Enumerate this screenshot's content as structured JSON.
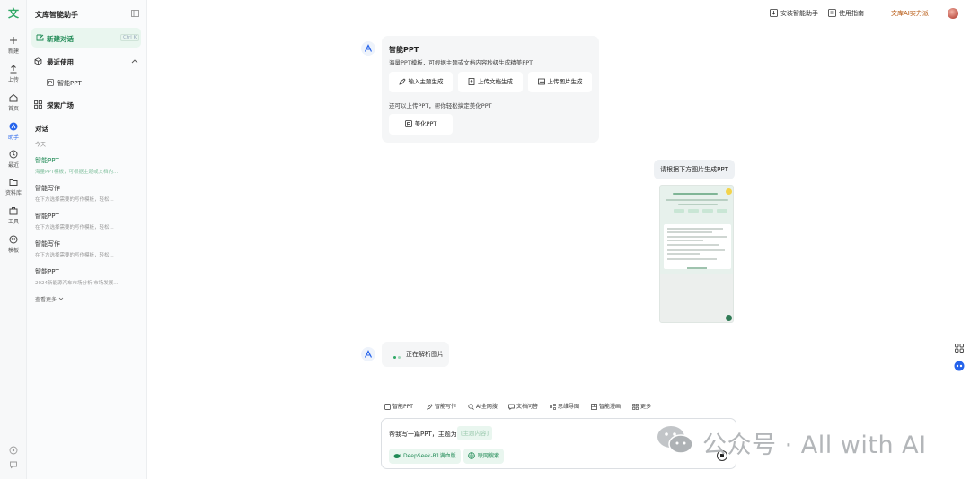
{
  "app": {
    "logo": "文",
    "title": "文库智能助手"
  },
  "rail": [
    {
      "name": "new",
      "label": "新建"
    },
    {
      "name": "upload",
      "label": "上传"
    },
    {
      "name": "home",
      "label": "首页"
    },
    {
      "name": "assistant",
      "label": "助手"
    },
    {
      "name": "recent",
      "label": "最近"
    },
    {
      "name": "library",
      "label": "资料库"
    },
    {
      "name": "tools",
      "label": "工具"
    },
    {
      "name": "templates",
      "label": "模板"
    }
  ],
  "sidebar": {
    "new_chat": "新建对话",
    "new_chat_kbd": "Ctrl K",
    "recent_title": "最近使用",
    "recent_items": [
      "智能PPT"
    ],
    "explore": "探索广场",
    "conversations_title": "对话",
    "today": "今天",
    "conversations": [
      {
        "title": "智能PPT",
        "desc": "海量PPT模板，可根据主题或文档内..."
      },
      {
        "title": "智能写作",
        "desc": "在下方选择需要的写作模板，轻松..."
      },
      {
        "title": "智能PPT",
        "desc": "在下方选择需要的写作模板，轻松..."
      },
      {
        "title": "智能写作",
        "desc": "在下方选择需要的写作模板，轻松..."
      },
      {
        "title": "智能PPT",
        "desc": "2024新能源汽车市场分析 市场发展..."
      }
    ],
    "see_more": "查看更多"
  },
  "topbar": {
    "install": "安装智能助手",
    "guide": "使用指南",
    "vip": "文库AI实力派"
  },
  "card": {
    "title": "智能PPT",
    "desc": "海量PPT模板，可根据主题或文档内容秒级生成精美PPT",
    "options": [
      "输入主题生成",
      "上传文档生成",
      "上传图片生成"
    ],
    "note": "还可以上传PPT，帮你轻松搞定美化PPT",
    "beautify": "美化PPT"
  },
  "user_message": "请根据下方图片生成PPT",
  "parsing": "正在解析图片",
  "tools": [
    "智能PPT",
    "智能写作",
    "AI全网搜",
    "文档问答",
    "思维导图",
    "智能漫画",
    "更多"
  ],
  "composer": {
    "prompt": "帮我写一篇PPT，主题为",
    "slot": "[主题内容]",
    "chips": [
      "DeepSeek-R1满血版",
      "联网搜索"
    ]
  },
  "watermark": "公众号 · All with AI",
  "colors": {
    "accent": "#1f8a55",
    "accent_bg": "#e9f6ef",
    "vip": "#b45309"
  }
}
